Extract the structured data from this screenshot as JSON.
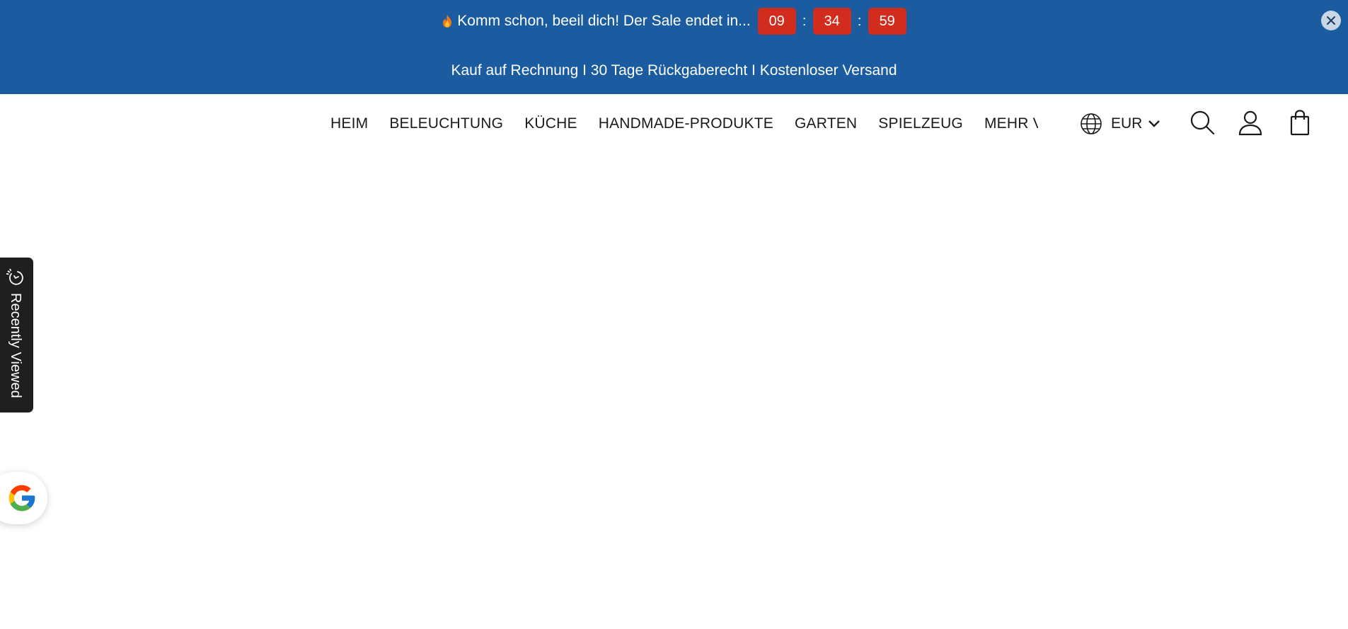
{
  "announcement": {
    "countdown_text": "Komm schon, beeil dich! Der Sale endet in...",
    "hours": "09",
    "minutes": "34",
    "seconds": "59",
    "separator": ":",
    "info_text": "Kauf auf Rechnung I 30 Tage Rückgaberecht I Kostenloser Versand",
    "background_color": "#1b5ca1",
    "timer_color": "#d12c1d",
    "icons": [
      "flame-icon",
      "close-icon"
    ]
  },
  "nav": {
    "items": [
      "HEIM",
      "BELEUCHTUNG",
      "KÜCHE",
      "HANDMADE-PRODUKTE",
      "GARTEN",
      "SPIELZEUG",
      "MEHR V"
    ]
  },
  "header": {
    "currency": "EUR",
    "icons": [
      "globe-icon",
      "chevron-down-icon",
      "search-icon",
      "account-icon",
      "cart-icon"
    ]
  },
  "recently_viewed": {
    "label": "Recently Viewed",
    "icon": "recently-viewed-icon"
  },
  "google_badge": {
    "icon": "google-icon"
  }
}
